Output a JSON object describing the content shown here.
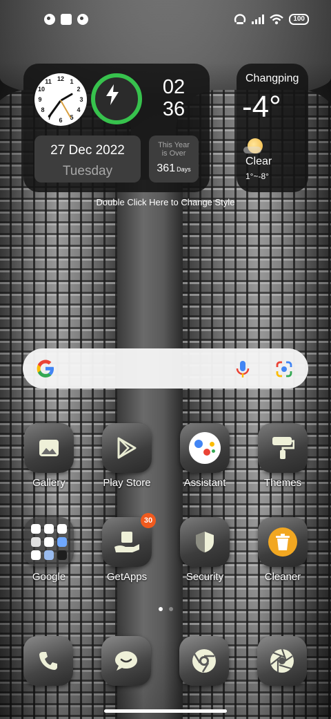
{
  "status_bar": {
    "battery": "100",
    "left_icons": [
      "notification-icon",
      "gallery-notification-icon",
      "notification-icon"
    ],
    "right_icons": [
      "hotspot-icon",
      "signal-icon",
      "wifi-icon",
      "battery-icon"
    ]
  },
  "clock_widget": {
    "analog_numbers": [
      "12",
      "1",
      "2",
      "3",
      "4",
      "5",
      "6",
      "7",
      "8",
      "9",
      "10",
      "11"
    ],
    "hour": "02",
    "minute": "36",
    "date": "27 Dec 2022",
    "weekday": "Tuesday",
    "year_over_line1": "This Year",
    "year_over_line2": "is Over",
    "days_count": "361",
    "days_label": "Days",
    "charge_color": "#37c24d"
  },
  "hint": "Double Click Here to Change Style",
  "weather": {
    "city": "Changping",
    "temperature": "-4°",
    "condition": "Clear",
    "range": "1°~-8°",
    "icon": "sun-icon"
  },
  "search": {
    "logo": "google-logo",
    "mic_icon": "mic-icon",
    "lens_icon": "lens-icon"
  },
  "apps_row1": [
    {
      "label": "Gallery",
      "icon": "gallery-icon"
    },
    {
      "label": "Play Store",
      "icon": "play-store-icon"
    },
    {
      "label": "Assistant",
      "icon": "assistant-icon"
    },
    {
      "label": "Themes",
      "icon": "themes-icon"
    }
  ],
  "apps_row2": [
    {
      "label": "Google",
      "icon": "folder-icon"
    },
    {
      "label": "GetApps",
      "icon": "getapps-icon",
      "badge": "30"
    },
    {
      "label": "Security",
      "icon": "shield-icon"
    },
    {
      "label": "Cleaner",
      "icon": "cleaner-icon"
    }
  ],
  "dock": [
    {
      "icon": "phone-icon"
    },
    {
      "icon": "messages-icon"
    },
    {
      "icon": "chrome-icon"
    },
    {
      "icon": "camera-icon"
    }
  ],
  "pages": {
    "current": 1,
    "total": 2
  }
}
